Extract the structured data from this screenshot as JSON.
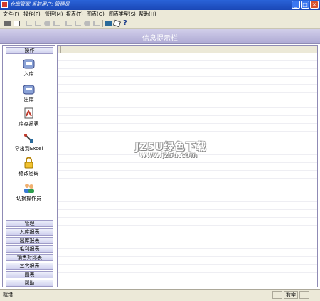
{
  "window": {
    "title": "仓库管家  当前用户: 管理员",
    "minimize": "_",
    "maximize": "□",
    "close": "×"
  },
  "menu": [
    {
      "label": "文件(F)"
    },
    {
      "label": "操作(P)"
    },
    {
      "label": "管理(M)"
    },
    {
      "label": "报表(T)"
    },
    {
      "label": "图表(G)"
    },
    {
      "label": "图表类型(S)"
    },
    {
      "label": "帮助(H)"
    }
  ],
  "banner": {
    "title": "信息提示栏"
  },
  "left_panel": {
    "operation_header": "操作",
    "operations": [
      {
        "label": "入库",
        "icon": "stock-in-icon"
      },
      {
        "label": "出库",
        "icon": "stock-out-icon"
      },
      {
        "label": "库存报表",
        "icon": "inventory-report-icon"
      },
      {
        "label": "导出到Excel",
        "icon": "export-excel-icon"
      },
      {
        "label": "修改密码",
        "icon": "lock-icon"
      },
      {
        "label": "切换操作员",
        "icon": "switch-user-icon"
      }
    ],
    "sections": [
      {
        "label": "管理"
      },
      {
        "label": "入库报表"
      },
      {
        "label": "出库报表"
      },
      {
        "label": "毛利报表"
      },
      {
        "label": "销售对比表"
      },
      {
        "label": "其它报表"
      },
      {
        "label": "图表"
      },
      {
        "label": "帮助"
      }
    ]
  },
  "watermark": {
    "line1": "JZ5U绿色下载",
    "line2": "www.jz5u.com"
  },
  "status": {
    "text": "就绪",
    "num": "数字"
  }
}
